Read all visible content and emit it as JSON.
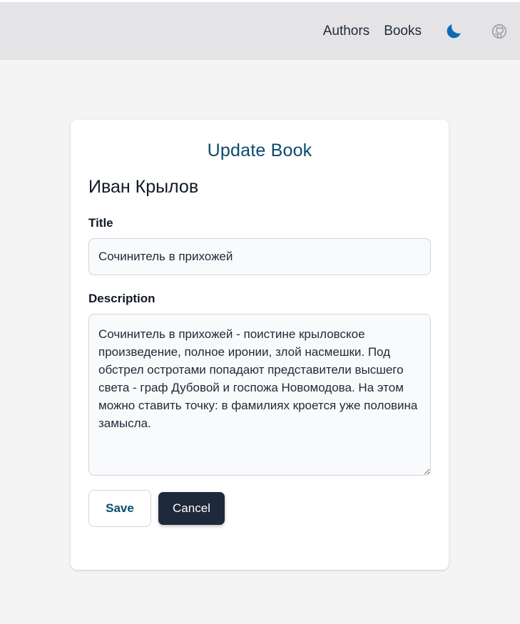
{
  "nav": {
    "links": [
      "Authors",
      "Books"
    ],
    "theme_icon": "moon-icon",
    "github_icon": "github-icon",
    "accent_color": "#0c6bb5"
  },
  "form": {
    "heading": "Update Book",
    "author": "Иван Крылов",
    "title_label": "Title",
    "title_value": "Сочинитель в прихожей",
    "description_label": "Description",
    "description_value": "Сочинитель в прихожей - поистине крыловское произведение, полное иронии, злой насмешки. Под обстрел остротами попадают представители высшего света - граф Дубовой и госпожа Новомодова. На этом можно ставить точку: в фамилиях кроется уже половина замысла.",
    "save_label": "Save",
    "cancel_label": "Cancel"
  }
}
